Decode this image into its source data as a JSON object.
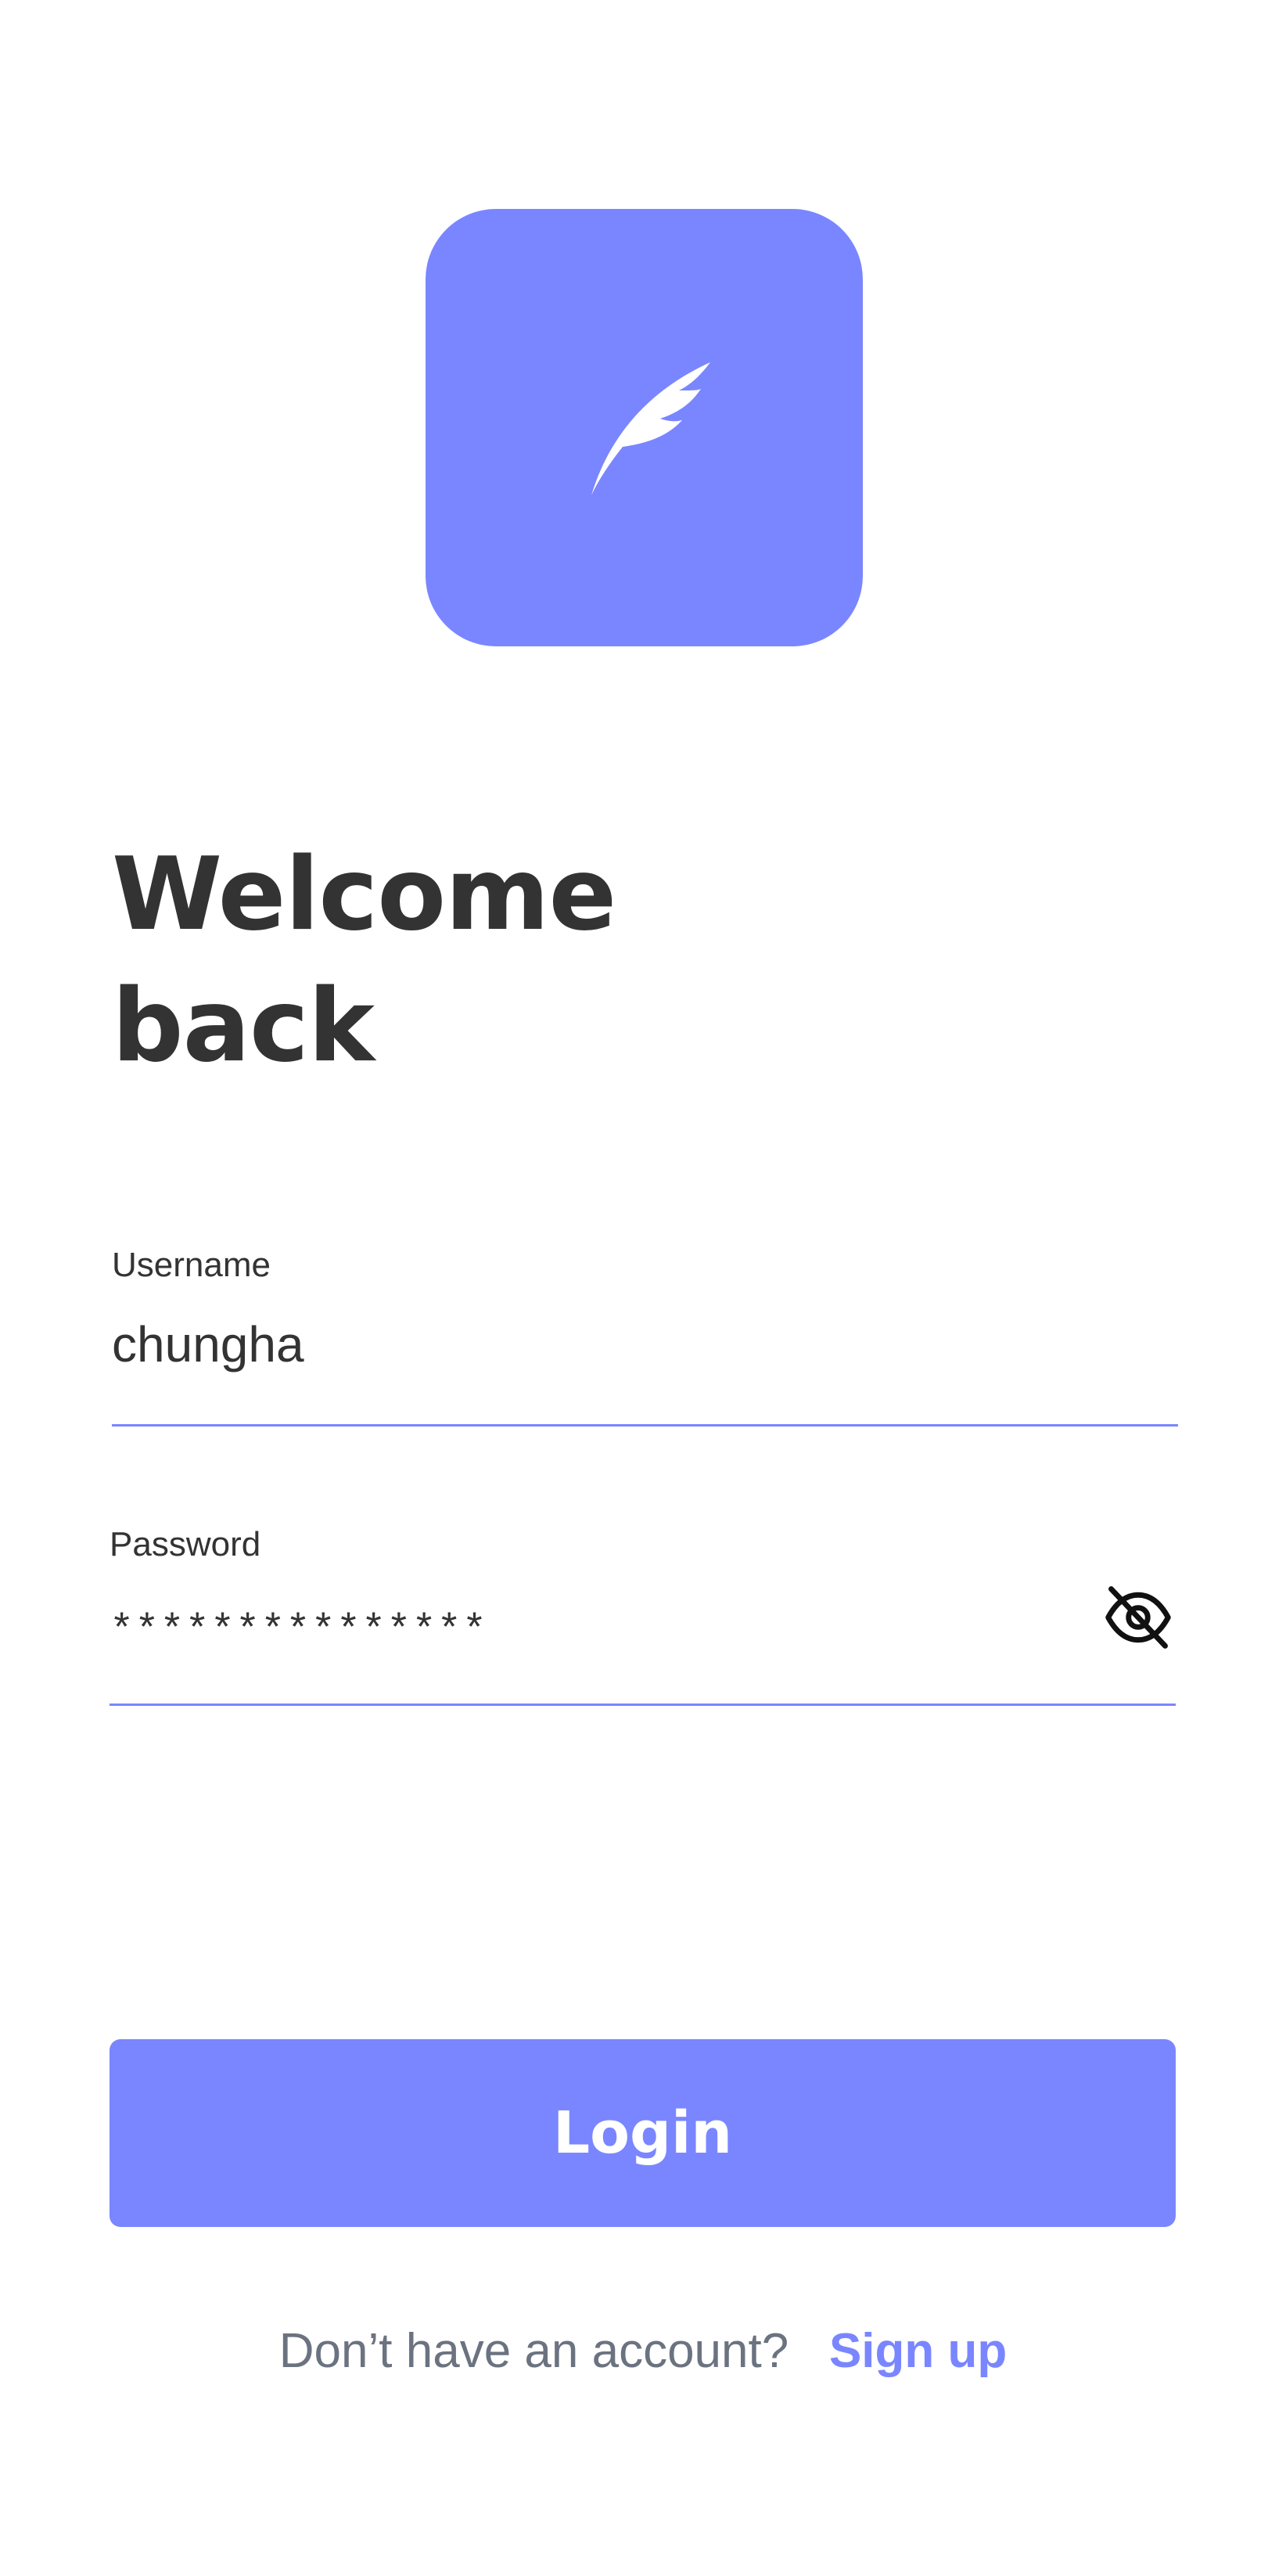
{
  "colors": {
    "accent": "#7a86ff",
    "text_dark": "#333333",
    "text_muted": "#6b7280",
    "background": "#ffffff"
  },
  "logo": {
    "icon": "feather-icon"
  },
  "header": {
    "title_line1": "Welcome",
    "title_line2": "back"
  },
  "form": {
    "username": {
      "label": "Username",
      "value": "chungha"
    },
    "password": {
      "label": "Password",
      "value": "***************",
      "toggle_icon": "eye-off-icon"
    },
    "login_label": "Login"
  },
  "footer": {
    "prompt": "Don’t have an account?",
    "signup_label": "Sign up"
  }
}
